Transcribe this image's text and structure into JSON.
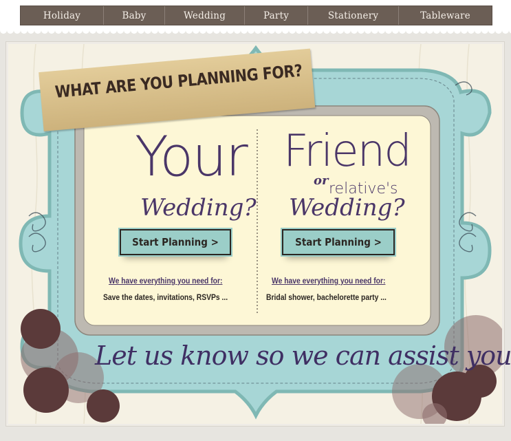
{
  "nav": {
    "items": [
      {
        "label": "Holiday"
      },
      {
        "label": "Baby"
      },
      {
        "label": "Wedding"
      },
      {
        "label": "Party"
      },
      {
        "label": "Stationery"
      },
      {
        "label": "Tableware"
      }
    ]
  },
  "banner": {
    "title": "WHAT ARE YOU PLANNING FOR?"
  },
  "left_panel": {
    "big": "Your",
    "script": "Wedding?",
    "button": "Start Planning >",
    "need_label": "We have everything you need for:",
    "description": "Save the dates, invitations, RSVPs ..."
  },
  "right_panel": {
    "big": "Friend",
    "or": "or",
    "relative": "relative's",
    "script": "Wedding?",
    "button": "Start Planning >",
    "need_label": "We have everything you need for:",
    "description": "Bridal shower, bachelorette party ..."
  },
  "tagline": "Let us know so we can assist you!",
  "colors": {
    "nav_bg": "#6b5e55",
    "frame_teal": "#a7d6d6",
    "panel_cream": "#fdf7d6",
    "accent_purple": "#4a3668",
    "button_teal": "#9bcec8",
    "dot_brown": "#5b3a3a"
  }
}
